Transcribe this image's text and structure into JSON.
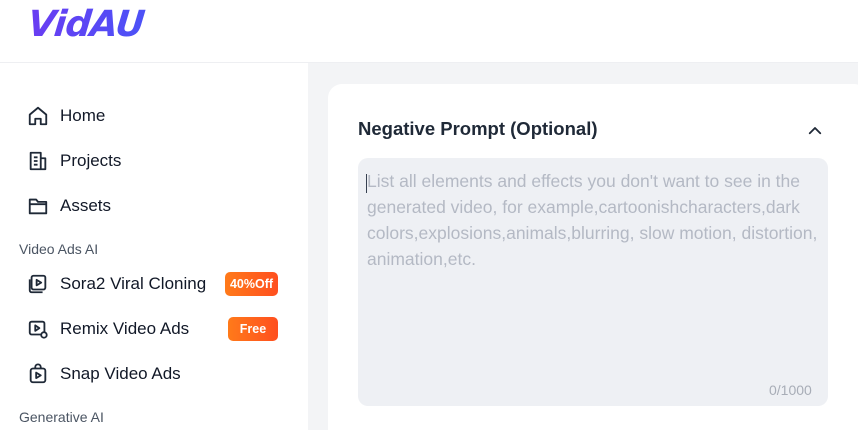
{
  "brand": {
    "logo": "VidAU"
  },
  "sidebar": {
    "items": [
      {
        "label": "Home",
        "icon": "home-icon"
      },
      {
        "label": "Projects",
        "icon": "projects-icon"
      },
      {
        "label": "Assets",
        "icon": "folder-icon"
      }
    ],
    "sections": [
      {
        "title": "Video Ads AI",
        "items": [
          {
            "label": "Sora2 Viral Cloning",
            "icon": "video-clone-icon",
            "badge": "40%Off"
          },
          {
            "label": "Remix Video Ads",
            "icon": "remix-video-icon",
            "badge": "Free"
          },
          {
            "label": "Snap Video Ads",
            "icon": "snap-video-icon"
          }
        ]
      },
      {
        "title": "Generative AI",
        "items": []
      }
    ]
  },
  "main": {
    "section_title": "Negative Prompt (Optional)",
    "prompt": {
      "value": "",
      "placeholder": "List all elements and effects you don't want to see in the generated video, for example,cartoonishcharacters,dark colors,explosions,animals,blurring, slow motion, distortion, animation,etc.",
      "counter": "0/1000"
    }
  },
  "colors": {
    "brand_start": "#6a3cf2",
    "brand_end": "#4c52f7",
    "badge_start": "#ff7a1a",
    "badge_end": "#ff4f1f",
    "main_bg": "#f3f4f6",
    "textarea_bg": "#eef0f4"
  }
}
